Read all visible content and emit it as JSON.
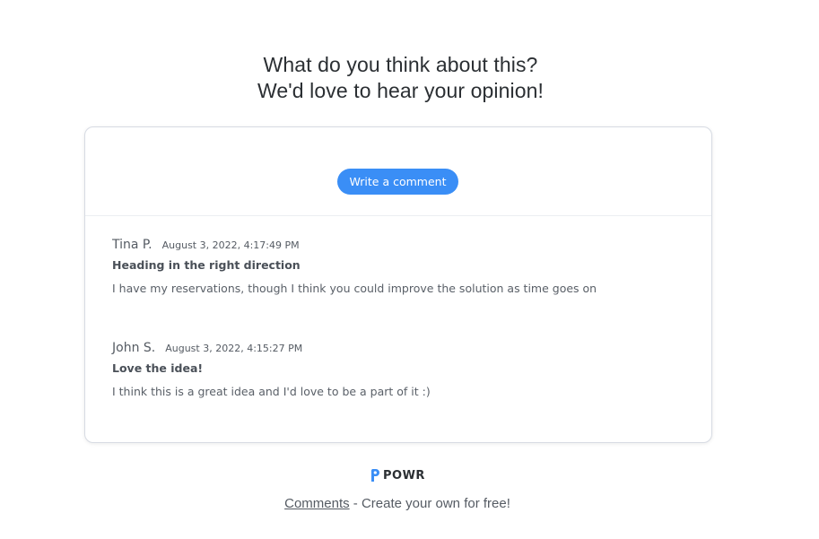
{
  "header": {
    "line1": "What do you think about this?",
    "line2": "We'd love to hear your opinion!"
  },
  "widget": {
    "write_button_label": "Write a comment",
    "comments": [
      {
        "author": "Tina P.",
        "timestamp": "August 3, 2022, 4:17:49 PM",
        "title": "Heading in the right direction",
        "body": "I have my reservations, though I think you could improve the solution as time goes on"
      },
      {
        "author": "John S.",
        "timestamp": "August 3, 2022, 4:15:27 PM",
        "title": "Love the idea!",
        "body": "I think this is a great idea and I'd love to be a part of it :)"
      }
    ]
  },
  "footer": {
    "logo_text": "POWR",
    "logo_icon": "powr-logo-icon",
    "link_text": "Comments",
    "tagline": " - Create your own for free!"
  },
  "colors": {
    "accent": "#3a8ef6",
    "text": "#555b63",
    "border": "#d7dbe3"
  }
}
